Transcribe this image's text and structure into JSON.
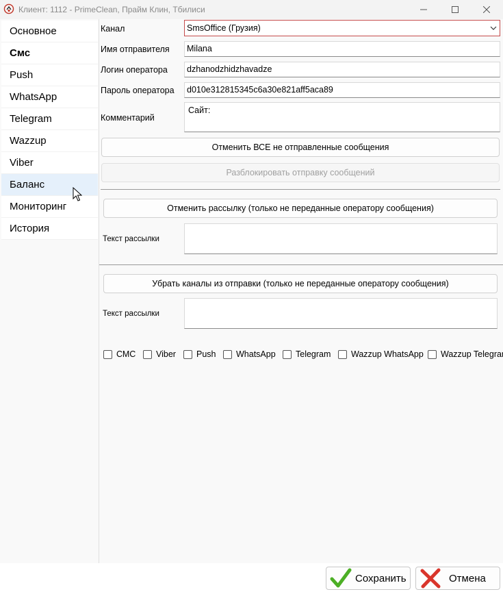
{
  "window": {
    "title": "Клиент: 1112 - PrimeClean, Прайм Клин, Тбилиси"
  },
  "sidebar": {
    "items": [
      {
        "label": "Основное",
        "name": "sidebar-item-osnovnoe"
      },
      {
        "label": "Смс",
        "name": "sidebar-item-sms"
      },
      {
        "label": "Push",
        "name": "sidebar-item-push"
      },
      {
        "label": "WhatsApp",
        "name": "sidebar-item-whatsapp"
      },
      {
        "label": "Telegram",
        "name": "sidebar-item-telegram"
      },
      {
        "label": "Wazzup",
        "name": "sidebar-item-wazzup"
      },
      {
        "label": "Viber",
        "name": "sidebar-item-viber"
      },
      {
        "label": "Баланс",
        "name": "sidebar-item-balance"
      },
      {
        "label": "Мониторинг",
        "name": "sidebar-item-monitoring"
      },
      {
        "label": "История",
        "name": "sidebar-item-history"
      }
    ],
    "active_index": 1,
    "hover_index": 7
  },
  "form": {
    "channel": {
      "label": "Канал",
      "value": "SmsOffice (Грузия)"
    },
    "sender": {
      "label": "Имя отправителя",
      "value": "Milana"
    },
    "login": {
      "label": "Логин оператора",
      "value": "dzhanodzhidzhavadze"
    },
    "password": {
      "label": "Пароль оператора",
      "value": "d010e312815345c6a30e821aff5aca89"
    },
    "comment": {
      "label": "Комментарий",
      "value": "Сайт:"
    }
  },
  "buttons": {
    "cancel_all": "Отменить ВСЕ не отправленные сообщения",
    "unblock": "Разблокировать отправку сообщений",
    "cancel_mailing": "Отменить рассылку (только не переданные оператору сообщения)",
    "remove_channels": "Убрать каналы из отправки (только не переданные оператору сообщения)"
  },
  "mailing1": {
    "label": "Текст рассылки",
    "value": ""
  },
  "mailing2": {
    "label": "Текст рассылки",
    "value": ""
  },
  "channels": [
    "СМС",
    "Viber",
    "Push",
    "WhatsApp",
    "Telegram",
    "Wazzup WhatsApp",
    "Wazzup Telegram"
  ],
  "footer": {
    "save": "Сохранить",
    "cancel": "Отмена"
  },
  "colors": {
    "save_icon": "#4caf25",
    "cancel_icon": "#d9352b",
    "hover_bg": "#e5f0fb",
    "select_border": "#c44a4a"
  }
}
